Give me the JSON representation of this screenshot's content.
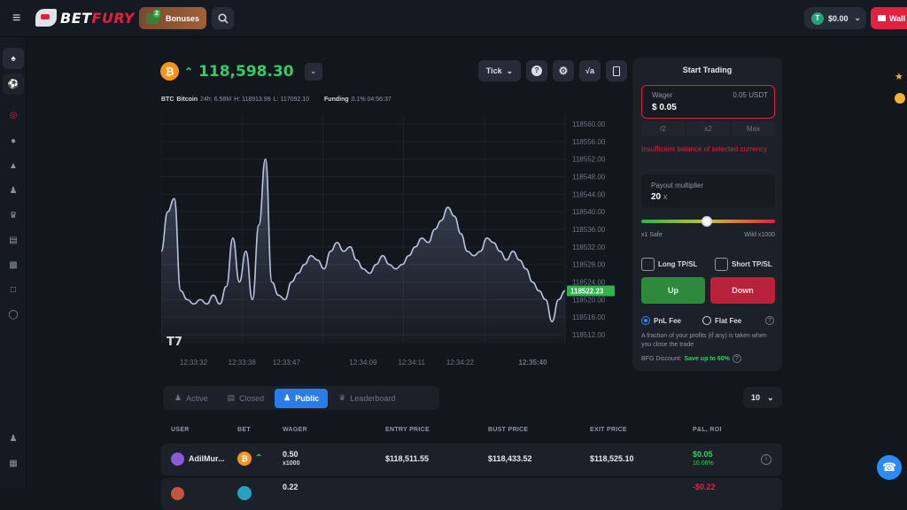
{
  "header": {
    "brand_a": "BET",
    "brand_b": "FURY",
    "bonuses_label": "Bonuses",
    "bonuses_count": "2",
    "balance": "$0.00",
    "wallet_label": "Wall"
  },
  "asset": {
    "price": "118,598.30",
    "ticker": "BTC",
    "name": "Bitcoin",
    "vol": "24h: 6.58M",
    "high": "H: 118913.99",
    "low": "L: 117092.10",
    "funding_label": "Funding",
    "funding_value": "0.1% 04:56:37"
  },
  "toolbar": {
    "interval": "Tick"
  },
  "chart_data": {
    "type": "line",
    "y_ticks": [
      "118560.00",
      "118556.00",
      "118552.00",
      "118548.00",
      "118544.00",
      "118540.00",
      "118536.00",
      "118532.00",
      "118528.00",
      "118524.00",
      "118520.00",
      "118516.00",
      "118512.00"
    ],
    "x_ticks": [
      "12:33:32",
      "12:33:38",
      "12:33:47",
      "12:34:09",
      "12:34:11",
      "12:34:22",
      "12:35:40"
    ],
    "current_price_label": "118522.23",
    "ylim": [
      118510,
      118562
    ],
    "y": [
      118531,
      118540,
      118543,
      118522,
      118520,
      118519,
      118520,
      118519,
      118521,
      118519,
      118523,
      118534,
      118524,
      118531,
      118520,
      118537,
      118552,
      118524,
      118521,
      118520,
      118524,
      118526,
      118528,
      118530,
      118529,
      118527,
      118531,
      118533,
      118531,
      118532,
      118529,
      118527,
      118526,
      118528,
      118530,
      118528,
      118527,
      118528,
      118530,
      118532,
      118534,
      118533,
      118536,
      118538,
      118541,
      118539,
      118535,
      118531,
      118530,
      118531,
      118534,
      118533,
      118531,
      118529,
      118531,
      118529,
      118527,
      118524,
      118522,
      118520,
      118515,
      118520,
      118522
    ]
  },
  "trade": {
    "title": "Start Trading",
    "wager_label": "Wager",
    "wager_min": "0.05 USDT",
    "wager_value": "$ 0.05",
    "half": "/2",
    "double": "x2",
    "max": "Max",
    "error": "Insufficient balance of selected currency",
    "payout_label": "Payout multiplier",
    "payout_value": "20",
    "payout_unit": "x",
    "safe_label": "x1 Safe",
    "wild_label": "Wild x1000",
    "long_label": "Long TP/SL",
    "short_label": "Short TP/SL",
    "up_label": "Up",
    "down_label": "Down",
    "pnl_fee": "PnL Fee",
    "flat_fee": "Flat Fee",
    "fee_note": "A fraction of your profits (if any) is taken when you close the trade",
    "discount_label": "BFG Discount:",
    "discount_value": "Save up to 60%"
  },
  "tabs": [
    "Active",
    "Closed",
    "Public",
    "Leaderboard"
  ],
  "rows_per_page": "10",
  "table": {
    "headers": [
      "USER",
      "BET",
      "WAGER",
      "ENTRY PRICE",
      "BUST PRICE",
      "EXIT PRICE",
      "P&L, ROI"
    ],
    "rows": [
      {
        "user": "AdilMur...",
        "wager": "0.50",
        "mult": "x1000",
        "entry": "$118,511.55",
        "bust": "$118,433.52",
        "exit": "$118,525.10",
        "pnl": "$0.05",
        "roi": "10.06%"
      },
      {
        "wager": "0.22",
        "pnl": "-$0.22"
      }
    ]
  }
}
